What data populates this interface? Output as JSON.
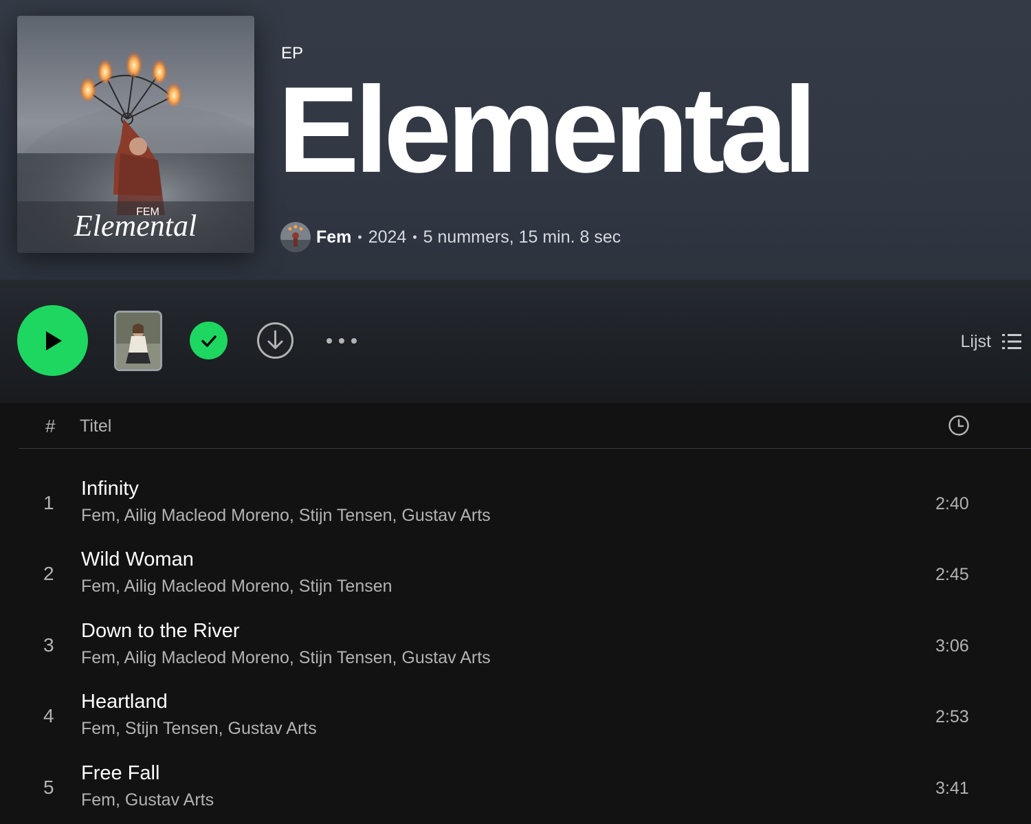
{
  "header": {
    "type_label": "EP",
    "title": "Elemental",
    "cover_text": {
      "small": "FEM",
      "large": "Elemental"
    },
    "artist": "Fem",
    "year": "2024",
    "separator": "•",
    "summary": "5 nummers, 15 min. 8 sec"
  },
  "actions": {
    "play_icon": "play-icon",
    "saved_icon": "check-icon",
    "download_icon": "download-icon",
    "more_icon": "more-icon",
    "view_label": "Lijst",
    "view_icon": "list-icon"
  },
  "table": {
    "col_number": "#",
    "col_title": "Titel",
    "col_duration_icon": "clock-icon"
  },
  "tracks": [
    {
      "number": "1",
      "title": "Infinity",
      "artists": "Fem, Ailig Macleod Moreno, Stijn Tensen, Gustav Arts",
      "duration": "2:40"
    },
    {
      "number": "2",
      "title": "Wild Woman",
      "artists": "Fem, Ailig Macleod Moreno, Stijn Tensen",
      "duration": "2:45"
    },
    {
      "number": "3",
      "title": "Down to the River",
      "artists": "Fem, Ailig Macleod Moreno, Stijn Tensen, Gustav Arts",
      "duration": "3:06"
    },
    {
      "number": "4",
      "title": "Heartland",
      "artists": "Fem, Stijn Tensen, Gustav Arts",
      "duration": "2:53"
    },
    {
      "number": "5",
      "title": "Free Fall",
      "artists": "Fem, Gustav Arts",
      "duration": "3:41"
    }
  ],
  "colors": {
    "accent": "#1ed760",
    "header_bg": "#333a45",
    "page_bg": "#121212",
    "text_primary": "#ffffff",
    "text_secondary": "#b3b3b3"
  }
}
